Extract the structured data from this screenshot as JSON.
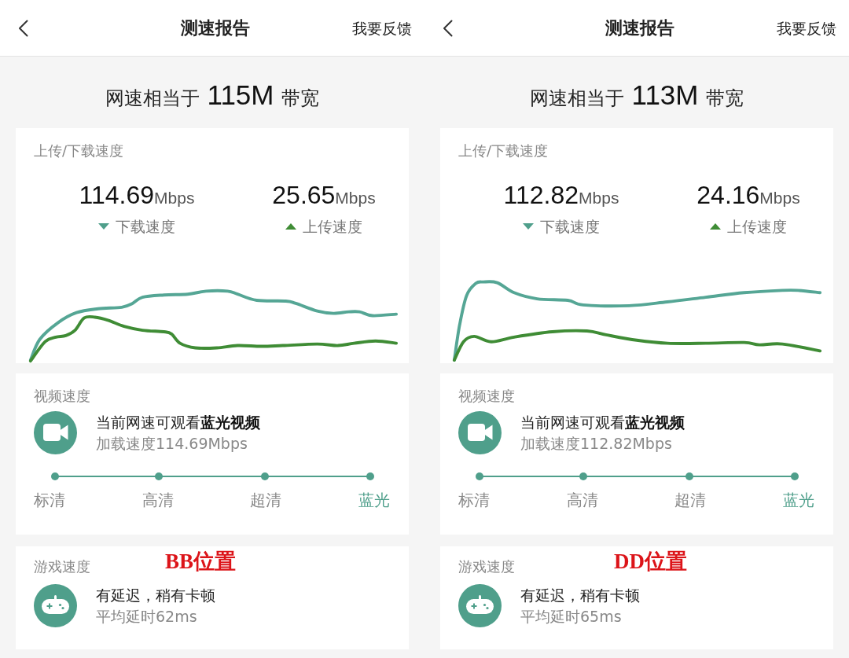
{
  "screens": [
    {
      "header": {
        "title": "测速报告",
        "action": "我要反馈"
      },
      "summary": {
        "prefix": "网速相当于",
        "value": "115M",
        "suffix": "带宽"
      },
      "speed_card": {
        "title": "上传/下载速度",
        "stats": [
          {
            "kind": "download",
            "value": "114.69",
            "unit": "Mbps",
            "label": "下载速度"
          },
          {
            "kind": "upload",
            "value": "25.65",
            "unit": "Mbps",
            "label": "上传速度"
          }
        ]
      },
      "video_card": {
        "title": "视频速度",
        "headline": "当前网速可观看**蓝光视频**",
        "detail": "加载速度114.69Mbps",
        "levels": [
          {
            "label": "标清",
            "selected": false
          },
          {
            "label": "高清",
            "selected": false
          },
          {
            "label": "超清",
            "selected": false
          },
          {
            "label": "蓝光",
            "selected": true
          }
        ]
      },
      "game_card": {
        "title": "游戏速度",
        "annotation": "BB位置",
        "headline": "有延迟，稍有卡顿",
        "detail": "平均延时62ms"
      }
    },
    {
      "header": {
        "title": "测速报告",
        "action": "我要反馈"
      },
      "summary": {
        "prefix": "网速相当于",
        "value": "113M",
        "suffix": "带宽"
      },
      "speed_card": {
        "title": "上传/下载速度",
        "stats": [
          {
            "kind": "download",
            "value": "112.82",
            "unit": "Mbps",
            "label": "下载速度"
          },
          {
            "kind": "upload",
            "value": "24.16",
            "unit": "Mbps",
            "label": "上传速度"
          }
        ]
      },
      "video_card": {
        "title": "视频速度",
        "headline": "当前网速可观看**蓝光视频**",
        "detail": "加载速度112.82Mbps",
        "levels": [
          {
            "label": "标清",
            "selected": false
          },
          {
            "label": "高清",
            "selected": false
          },
          {
            "label": "超清",
            "selected": false
          },
          {
            "label": "蓝光",
            "selected": true
          }
        ]
      },
      "game_card": {
        "title": "游戏速度",
        "annotation": "DD位置",
        "headline": "有延迟，稍有卡顿",
        "detail": "平均延时65ms"
      }
    }
  ]
}
